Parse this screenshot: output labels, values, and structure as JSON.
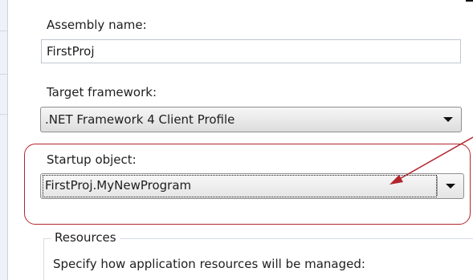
{
  "application": {
    "assembly_name_label": "Assembly name:",
    "assembly_name_value": "FirstProj",
    "target_framework_label": "Target framework:",
    "target_framework_value": ".NET Framework 4 Client Profile",
    "startup_object_label": "Startup object:",
    "startup_object_value": "FirstProj.MyNewProgram"
  },
  "resources": {
    "group_title": "Resources",
    "description": "Specify how application resources will be managed:"
  },
  "annotation": {
    "highlight_color": "#b3262d",
    "arrow_color": "#b3262d"
  }
}
